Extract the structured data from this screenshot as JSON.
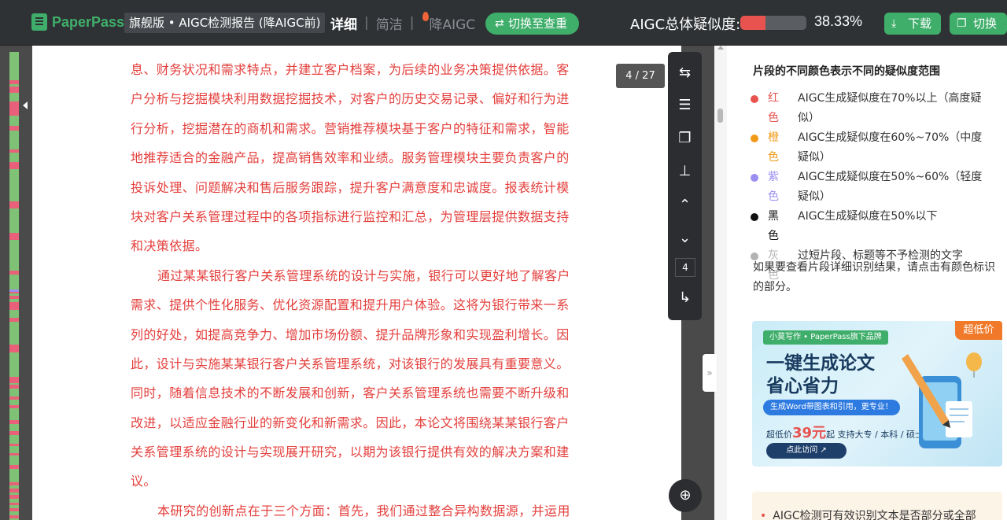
{
  "app": {
    "logo": "PaperPass",
    "edition": "旗舰版 • AIGC检测报告 (降AIGC前)"
  },
  "view_tabs": {
    "detail": "详细",
    "simple": "简洁",
    "reduce": "降AIGC"
  },
  "switch_button": "切换至查重",
  "summary": {
    "label": "AIGC总体疑似度:",
    "percent_text": "38.33%",
    "percent_value": 38.33,
    "meter_color": "#e8534f"
  },
  "toolbar": {
    "download": "下载",
    "switch": "切换"
  },
  "page_indicator": "4 / 27",
  "tools": {
    "current_page": "4"
  },
  "doc_lines": [
    "息、财务状况和需求特点，并建立客户档案，为后续的业务决策提供依据。客",
    "户分析与挖掘模块利用数据挖掘技术，对客户的历史交易记录、偏好和行为进",
    "行分析，挖掘潜在的商机和需求。营销推荐模块基于客户的特征和需求，智能",
    "地推荐适合的金融产品，提高销售效率和业绩。服务管理模块主要负责客户的",
    "投诉处理、问题解决和售后服务跟踪，提升客户满意度和忠诚度。报表统计模",
    "块对客户关系管理过程中的各项指标进行监控和汇总，为管理层提供数据支持",
    "和决策依据。",
    "通过某某银行客户关系管理系统的设计与实施，银行可以更好地了解客户",
    "需求、提供个性化服务、优化资源配置和提升用户体验。这将为银行带来一系",
    "列的好处，如提高竞争力、增加市场份额、提升品牌形象和实现盈利增长。因",
    "此，设计与实施某某银行客户关系管理系统，对该银行的发展具有重要意义。",
    "同时，随着信息技术的不断发展和创新，客户关系管理系统也需要不断升级和",
    "改进，以适应金融行业的新变化和新需求。因此，本论文将围绕某某银行客户",
    "关系管理系统的设计与实现展开研究，以期为该银行提供有效的解决方案和建",
    "议。",
    "本研究的创新点在于三个方面：首先，我们通过整合异构数据源，并运用"
  ],
  "legend": {
    "title": "片段的不同颜色表示不同的疑似度范围",
    "items": [
      {
        "color": "#e8534f",
        "name": "红色",
        "desc": "AIGC生成疑似度在70%以上（高度疑似）"
      },
      {
        "color": "#f09a1a",
        "name": "橙色",
        "desc": "AIGC生成疑似度在60%~70%（中度疑似）"
      },
      {
        "color": "#9a8ef0",
        "name": "紫色",
        "desc": "AIGC生成疑似度在50%~60%（轻度疑似）"
      },
      {
        "color": "#111111",
        "name": "黑色",
        "desc": "AIGC生成疑似度在50%以下"
      },
      {
        "color": "#b3b3b3",
        "name": "灰色",
        "desc": "过短片段、标题等不予检测的文字"
      }
    ]
  },
  "hint": "如果要查看片段详细识别结果，请点击有颜色标识的部分。",
  "ad": {
    "tag": "小莫写作 • PaperPass旗下品牌",
    "badge": "超低价",
    "headline1": "一键生成论文",
    "headline2": "省心省力",
    "pill": "生成Word带图表和引用，更专业！",
    "price_prefix": "超低价",
    "price": "39元",
    "price_suffix": "起  支持大专 / 本科 / 硕士",
    "visit": "点此访问"
  },
  "notice": "AIGC检测可有效识别文本是否部分或全部"
}
